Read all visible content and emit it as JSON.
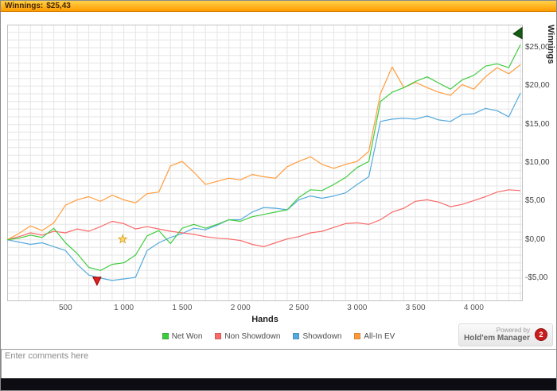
{
  "window": {
    "title_label": "Winnings:",
    "title_value": "$25,43"
  },
  "chart_data": {
    "type": "line",
    "xlabel": "Hands",
    "ylabel": "Winnings",
    "xlim": [
      0,
      4420
    ],
    "ylim": [
      -8,
      28
    ],
    "xgrid": 100,
    "ygrid": 1,
    "grid_color": "#e5e5e5",
    "x_ticks": [
      {
        "value": 500,
        "label": "500"
      },
      {
        "value": 1000,
        "label": "1 000"
      },
      {
        "value": 1500,
        "label": "1 500"
      },
      {
        "value": 2000,
        "label": "2 000"
      },
      {
        "value": 2500,
        "label": "2 500"
      },
      {
        "value": 3000,
        "label": "3 000"
      },
      {
        "value": 3500,
        "label": "3 500"
      },
      {
        "value": 4000,
        "label": "4 000"
      }
    ],
    "y_ticks": [
      {
        "value": -5,
        "label": "-$5,00"
      },
      {
        "value": 0,
        "label": "$0,00"
      },
      {
        "value": 5,
        "label": "$5,00"
      },
      {
        "value": 10,
        "label": "$10,00"
      },
      {
        "value": 15,
        "label": "$15,00"
      },
      {
        "value": 20,
        "label": "$20,00"
      },
      {
        "value": 25,
        "label": "$25,00"
      }
    ],
    "x": [
      0,
      100,
      200,
      300,
      400,
      500,
      600,
      700,
      800,
      900,
      1000,
      1100,
      1200,
      1300,
      1400,
      1500,
      1600,
      1700,
      1800,
      1900,
      2000,
      2100,
      2200,
      2300,
      2400,
      2500,
      2600,
      2700,
      2800,
      2900,
      3000,
      3100,
      3200,
      3300,
      3400,
      3500,
      3600,
      3700,
      3800,
      3900,
      4000,
      4100,
      4200,
      4300,
      4400
    ],
    "series": [
      {
        "name": "Showdown",
        "color": "#55aadd",
        "values": [
          0,
          -0.3,
          -0.6,
          -0.4,
          -0.9,
          -1.4,
          -3.2,
          -4.6,
          -5.0,
          -5.3,
          -5.1,
          -4.9,
          -1.4,
          -0.4,
          0.3,
          0.8,
          1.5,
          1.3,
          1.9,
          2.6,
          2.6,
          3.6,
          4.2,
          4.1,
          3.9,
          5.2,
          5.7,
          5.4,
          5.7,
          6.1,
          7.2,
          8.2,
          15.4,
          15.7,
          15.8,
          15.7,
          16.1,
          15.6,
          15.4,
          16.3,
          16.4,
          17.1,
          16.8,
          16.0,
          19.1
        ]
      },
      {
        "name": "Non Showdown",
        "color": "#f96a6a",
        "values": [
          0,
          0.4,
          0.9,
          0.6,
          1.1,
          0.9,
          1.4,
          1.1,
          1.7,
          2.4,
          2.1,
          1.4,
          1.7,
          1.4,
          1.1,
          0.9,
          0.7,
          0.4,
          0.2,
          0.1,
          -0.1,
          -0.6,
          -0.9,
          -0.4,
          0.1,
          0.4,
          0.9,
          1.1,
          1.6,
          2.1,
          2.2,
          2.0,
          2.6,
          3.6,
          4.1,
          5.0,
          5.2,
          4.9,
          4.3,
          4.6,
          5.1,
          5.6,
          6.2,
          6.5,
          6.4
        ]
      },
      {
        "name": "All-In EV",
        "color": "#ff9d3c",
        "values": [
          0,
          0.8,
          1.8,
          1.2,
          2.2,
          4.5,
          5.2,
          5.6,
          5.0,
          5.8,
          5.2,
          4.8,
          6.0,
          6.2,
          9.6,
          10.2,
          8.8,
          7.2,
          7.6,
          8.0,
          7.8,
          8.5,
          8.2,
          8.0,
          9.5,
          10.2,
          10.8,
          9.8,
          9.3,
          9.8,
          10.2,
          11.5,
          19.0,
          22.5,
          19.8,
          20.5,
          19.8,
          19.2,
          18.8,
          20.2,
          19.6,
          21.2,
          22.4,
          21.6,
          22.8
        ]
      },
      {
        "name": "Net Won",
        "color": "#3ecc3e",
        "values": [
          0,
          0.2,
          0.6,
          0.3,
          1.5,
          -0.4,
          -1.8,
          -3.6,
          -4.0,
          -3.2,
          -3.0,
          -2.0,
          0.5,
          1.2,
          -0.5,
          1.5,
          2.0,
          1.5,
          2.0,
          2.6,
          2.4,
          3.0,
          3.3,
          3.6,
          3.9,
          5.5,
          6.5,
          6.4,
          7.2,
          8.1,
          9.4,
          10.2,
          18.0,
          19.2,
          19.8,
          20.6,
          21.2,
          20.4,
          19.6,
          20.8,
          21.4,
          22.6,
          22.9,
          22.4,
          25.4
        ]
      }
    ],
    "markers": [
      {
        "type": "triangle-down",
        "name": "down-arrow-marker",
        "x": 770,
        "y": -5.9,
        "fill": "#dd2222",
        "stroke": "#990000"
      },
      {
        "type": "star",
        "name": "star-marker",
        "x": 990,
        "y": 0.0,
        "fill": "#ffd95e",
        "stroke": "#d89a1e"
      },
      {
        "type": "flag",
        "name": "end-flag-marker",
        "x": 4380,
        "y": 27.0,
        "fill": "#155c15",
        "stroke": "#0c3c0c"
      }
    ]
  },
  "legend": {
    "items": [
      {
        "label": "Net Won",
        "color": "#3ecc3e"
      },
      {
        "label": "Non Showdown",
        "color": "#f96a6a"
      },
      {
        "label": "Showdown",
        "color": "#55aadd"
      },
      {
        "label": "All-In EV",
        "color": "#ff9d3c"
      }
    ]
  },
  "powered_by": {
    "line1": "Powered by",
    "line2": "Hold'em Manager",
    "badge": "2"
  },
  "comments": {
    "placeholder": "Enter comments here"
  }
}
